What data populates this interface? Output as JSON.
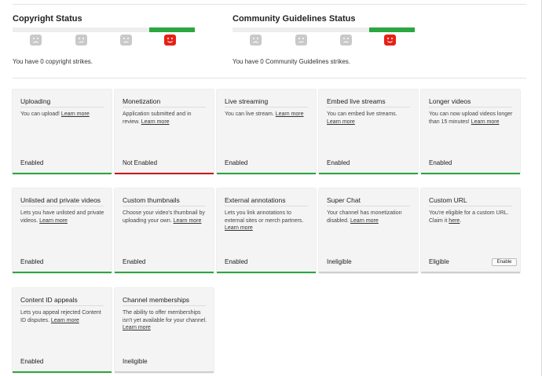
{
  "copyright": {
    "title": "Copyright Status",
    "strikes_text": "You have 0 copyright strikes.",
    "active_level": 3
  },
  "community": {
    "title": "Community Guidelines Status",
    "strikes_text": "You have 0 Community Guidelines strikes.",
    "active_level": 3
  },
  "colors": {
    "green": "#2ba640",
    "red": "#cc181e",
    "face_active": "#e62117"
  },
  "cards": [
    {
      "title": "Uploading",
      "desc": "You can upload!",
      "link": "Learn more",
      "status": "Enabled",
      "bar": "green"
    },
    {
      "title": "Monetization",
      "desc": "Application submitted and in review.",
      "link": "Learn more",
      "status": "Not Enabled",
      "bar": "red"
    },
    {
      "title": "Live streaming",
      "desc": "You can live stream.",
      "link": "Learn more",
      "status": "Enabled",
      "bar": "green"
    },
    {
      "title": "Embed live streams",
      "desc": "You can embed live streams.",
      "link": "Learn more",
      "status": "Enabled",
      "bar": "green"
    },
    {
      "title": "Longer videos",
      "desc": "You can now upload videos longer than 15 minutes!",
      "link": "Learn more",
      "status": "Enabled",
      "bar": "green"
    },
    {
      "title": "Unlisted and private videos",
      "desc": "Lets you have unlisted and private videos.",
      "link": "Learn more",
      "status": "Enabled",
      "bar": "green"
    },
    {
      "title": "Custom thumbnails",
      "desc": "Choose your video's thumbnail by uploading your own.",
      "link": "Learn more",
      "status": "Enabled",
      "bar": "green"
    },
    {
      "title": "External annotations",
      "desc": "Lets you link annotations to external sites or merch partners.",
      "link": "Learn more",
      "status": "Enabled",
      "bar": "green"
    },
    {
      "title": "Super Chat",
      "desc": "Your channel has monetization disabled.",
      "link": "Learn more",
      "status": "Ineligible",
      "bar": "gray"
    },
    {
      "title": "Custom URL",
      "desc": "You're eligible for a custom URL. Claim it",
      "link": "here",
      "link_suffix": ".",
      "status": "Eligible",
      "bar": "gray",
      "button": "Enable"
    },
    {
      "title": "Content ID appeals",
      "desc": "Lets you appeal rejected Content ID disputes.",
      "link": "Learn more",
      "status": "Enabled",
      "bar": "green"
    },
    {
      "title": "Channel memberships",
      "desc": "The ability to offer memberships isn't yet available for your channel.",
      "link": "Learn more",
      "status": "Ineligible",
      "bar": "gray"
    }
  ]
}
